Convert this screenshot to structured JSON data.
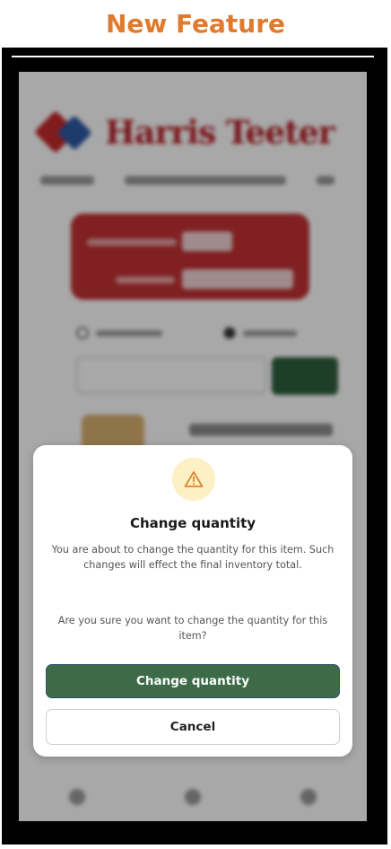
{
  "banner": {
    "title": "New Feature"
  },
  "background_app": {
    "brand": "Harris Teeter"
  },
  "dialog": {
    "icon": "warning-icon",
    "title": "Change quantity",
    "message": "You are about to change the quantity for this item. Such changes will effect the final inventory total.",
    "question": "Are you sure you want to change the quantity for this item?",
    "confirm_label": "Change quantity",
    "cancel_label": "Cancel"
  },
  "colors": {
    "banner_text": "#e07a2e",
    "confirm_button": "#3d6b47",
    "warning_bg": "#fdf0c4",
    "warning_icon": "#e0852c"
  }
}
